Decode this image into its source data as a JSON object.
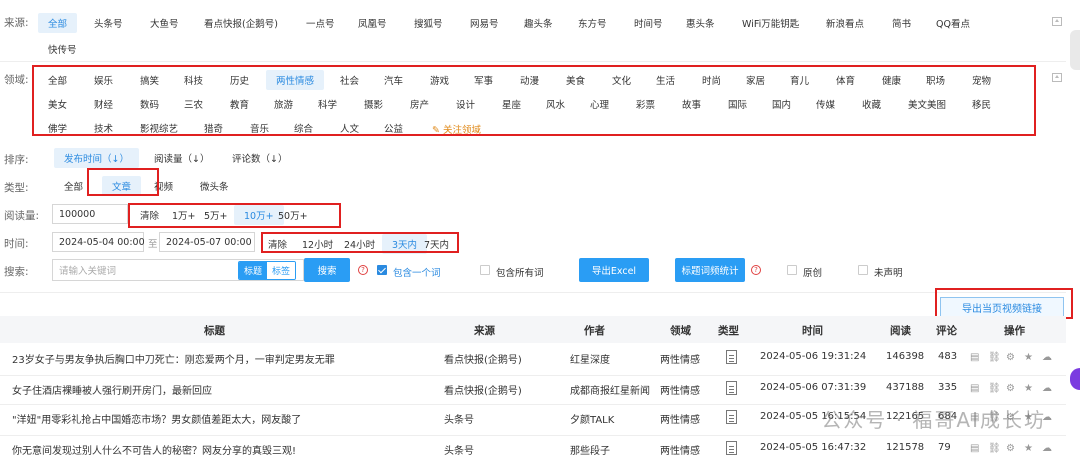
{
  "source": {
    "label": "来源:",
    "items": [
      "全部",
      "头条号",
      "大鱼号",
      "看点快报(企鹅号)",
      "一点号",
      "凤凰号",
      "搜狐号",
      "网易号",
      "趣头条",
      "东方号",
      "时间号",
      "惠头条",
      "WiFi万能钥匙",
      "新浪看点",
      "简书",
      "QQ看点"
    ],
    "items_row2": [
      "快传号"
    ],
    "selected": "全部"
  },
  "domain": {
    "label": "领域:",
    "row1": [
      "全部",
      "娱乐",
      "搞笑",
      "科技",
      "历史",
      "两性情感",
      "社会",
      "汽车",
      "游戏",
      "军事",
      "动漫",
      "美食",
      "文化",
      "生活",
      "时尚",
      "家居",
      "育儿",
      "体育",
      "健康",
      "职场",
      "宠物"
    ],
    "row2": [
      "美女",
      "财经",
      "数码",
      "三农",
      "教育",
      "旅游",
      "科学",
      "摄影",
      "房产",
      "设计",
      "星座",
      "风水",
      "心理",
      "彩票",
      "故事",
      "国际",
      "国内",
      "传媒",
      "收藏",
      "美文美图",
      "移民"
    ],
    "row3": [
      "佛学",
      "技术",
      "影视综艺",
      "猎奇",
      "音乐",
      "综合",
      "人文",
      "公益"
    ],
    "follow_label": "关注领域",
    "selected": "两性情感"
  },
  "sort": {
    "label": "排序:",
    "items": [
      "发布时间（↓）",
      "阅读量（↓）",
      "评论数（↓）"
    ],
    "selected": "发布时间（↓）"
  },
  "type": {
    "label": "类型:",
    "items": [
      "全部",
      "文章",
      "视频",
      "微头条"
    ],
    "selected": "文章"
  },
  "reads": {
    "label": "阅读量:",
    "value": "100000",
    "quick": [
      "清除",
      "1万+",
      "5万+",
      "10万+",
      "50万+"
    ],
    "selected": "10万+"
  },
  "time": {
    "label": "时间:",
    "from": "2024-05-04 00:00",
    "sep": "至",
    "to": "2024-05-07 00:00",
    "quick": [
      "清除",
      "12小时",
      "24小时",
      "3天内",
      "7天内"
    ],
    "selected": "3天内"
  },
  "search": {
    "label": "搜索:",
    "placeholder": "请输入关键词",
    "mode_title": "标题",
    "mode_tag": "标签",
    "button": "搜索",
    "include_one": "包含一个词",
    "include_all": "包含所有词",
    "export_excel": "导出Excel",
    "title_stats": "标题词频统计",
    "original": "原创",
    "undeclared": "未声明"
  },
  "export_video_links": "导出当页视频链接",
  "table": {
    "headers": [
      "标题",
      "来源",
      "作者",
      "领域",
      "类型",
      "时间",
      "阅读",
      "评论",
      "操作"
    ],
    "rows": [
      {
        "title": "23岁女子与男友争执后胸口中刀死亡：刚恋爱两个月，一审判定男友无罪",
        "source": "看点快报(企鹅号)",
        "author": "红星深度",
        "domain": "两性情感",
        "time": "2024-05-06 19:31:24",
        "reads": "146398",
        "comments": "483"
      },
      {
        "title": "女子住酒店裸睡被人强行刷开房门，最新回应",
        "source": "看点快报(企鹅号)",
        "author": "成都商报红星新闻",
        "domain": "两性情感",
        "time": "2024-05-06 07:31:39",
        "reads": "437188",
        "comments": "335"
      },
      {
        "title": "\"洋妞\"用零彩礼抢占中国婚恋市场？男女颜值差距太大，网友酸了",
        "source": "头条号",
        "author": "夕颜TALK",
        "domain": "两性情感",
        "time": "2024-05-05 16:15:54",
        "reads": "122165",
        "comments": "684"
      },
      {
        "title": "你无意间发现过别人什么不可告人的秘密？网友分享的真毁三观!",
        "source": "头条号",
        "author": "那些段子",
        "domain": "两性情感",
        "time": "2024-05-05 16:47:32",
        "reads": "121578",
        "comments": "79"
      }
    ]
  },
  "watermark": "公众号 · 福哥AI成长坊",
  "colors": {
    "accent": "#2a9df4",
    "highlight": "#e02020",
    "selected_bg": "#e6f1fb"
  }
}
